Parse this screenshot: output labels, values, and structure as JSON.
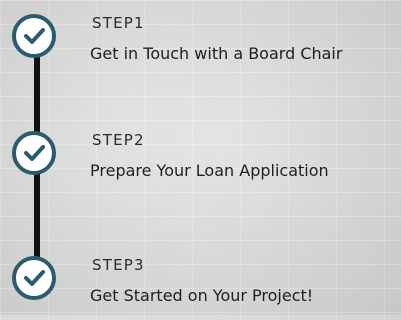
{
  "steps": [
    {
      "label": "STEP1",
      "description": "Get in Touch with a Board Chair",
      "icon": "check-icon"
    },
    {
      "label": "STEP2",
      "description": "Prepare Your Loan Application",
      "icon": "check-icon"
    },
    {
      "label": "STEP3",
      "description": "Get Started on Your Project!",
      "icon": "check-icon"
    }
  ],
  "colors": {
    "accent": "#2d5b6e",
    "line": "#111111",
    "background": "#d9d9d9"
  }
}
